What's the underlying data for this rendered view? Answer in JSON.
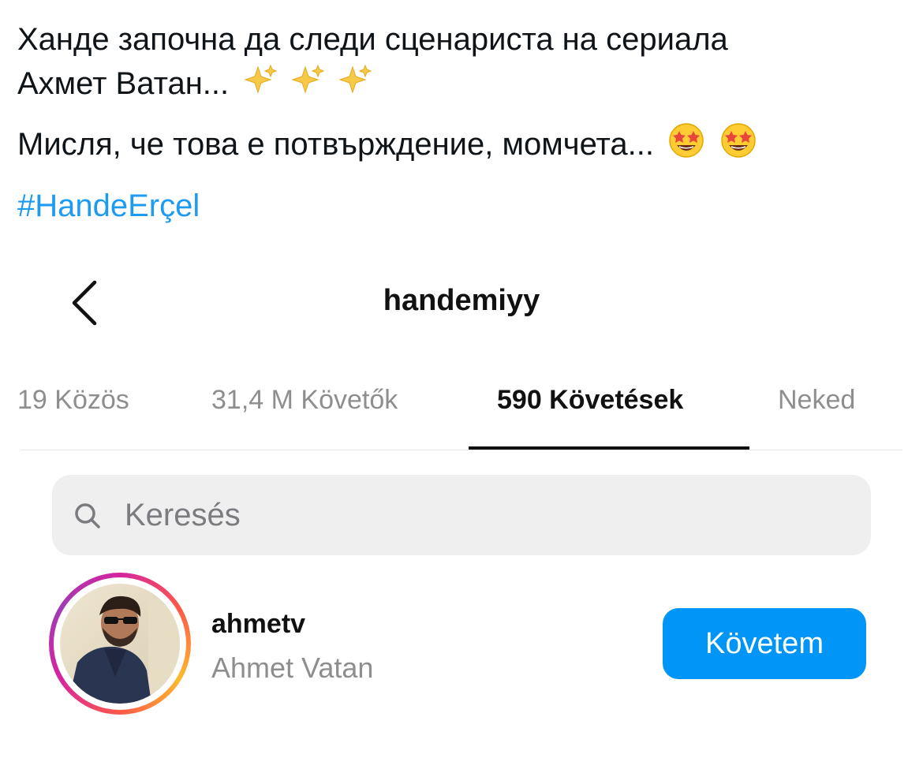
{
  "tweet": {
    "line1": "Ханде започна да следи сценариста на сериала",
    "line2": "Ахмет Ватан...",
    "line2_emoji": "sparkles-icon",
    "line3": "Мисля, че това е потвърждение, момчета...",
    "line3_emoji": "star-struck-icon",
    "hashtag": "#HandeErçel",
    "hashtag_color": "#1d9bf0"
  },
  "instagram": {
    "header": {
      "title": "handemiyy",
      "back_icon": "chevron-left-icon"
    },
    "tabs": [
      {
        "label": "19 Közös",
        "active": false
      },
      {
        "label": "31,4 M Követők",
        "active": false
      },
      {
        "label": "590 Követések",
        "active": true
      },
      {
        "label": "Neked",
        "active": false
      }
    ],
    "search": {
      "placeholder": "Keresés",
      "icon": "search-icon"
    },
    "result": {
      "username": "ahmetv",
      "full_name": "Ahmet Vatan",
      "button_label": "Követem",
      "button_color": "#0095f6"
    }
  }
}
